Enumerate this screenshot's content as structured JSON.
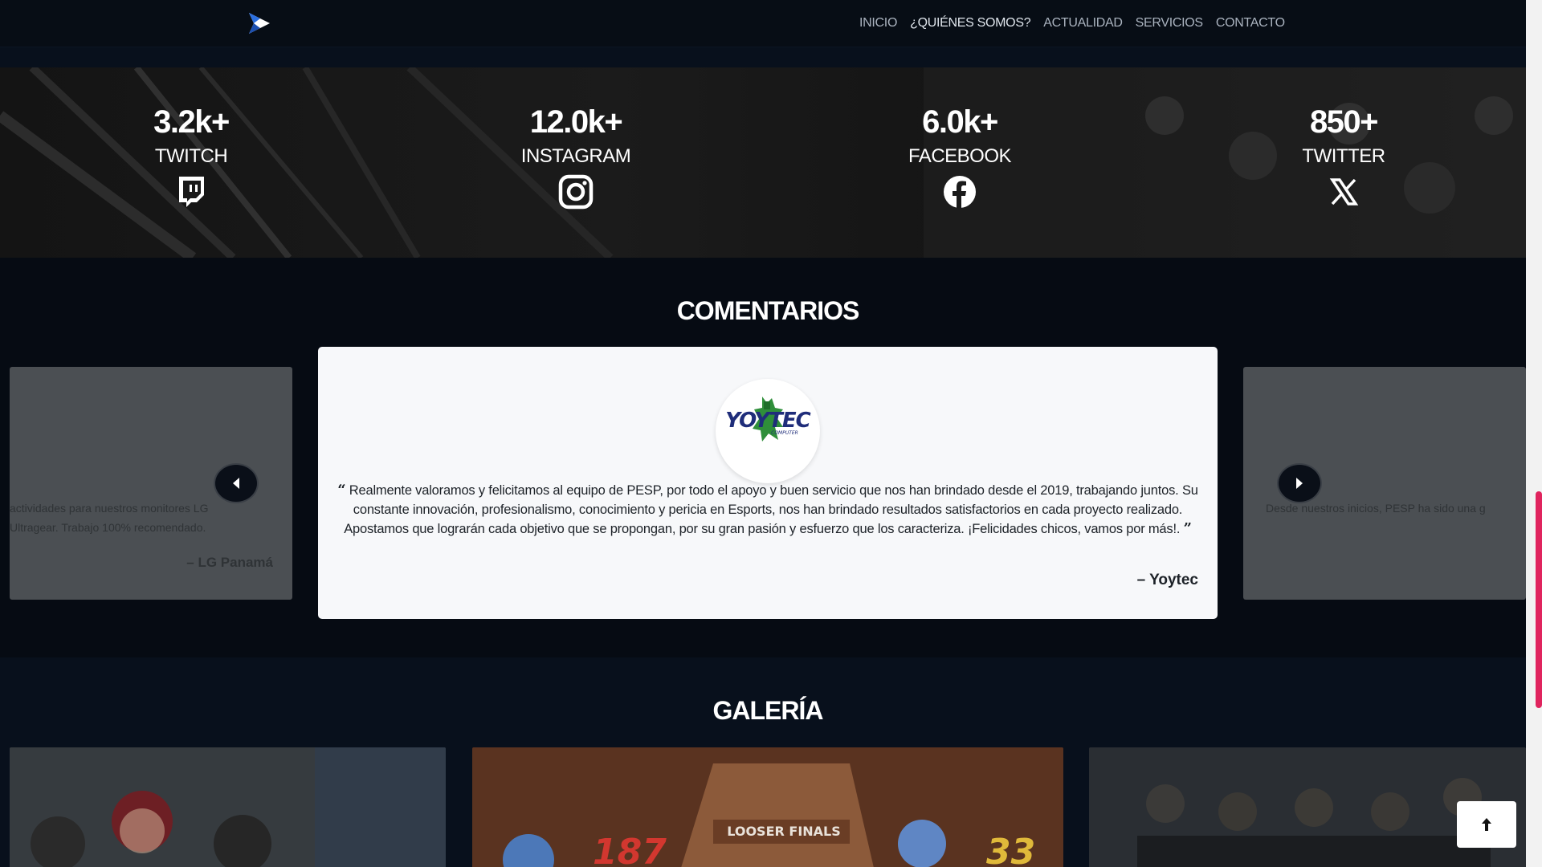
{
  "nav": {
    "logo_icon": "pesp-logo-icon",
    "links": [
      "INICIO",
      "¿QUIÉNES SOMOS?",
      "ACTUALIDAD",
      "SERVICIOS",
      "CONTACTO"
    ]
  },
  "stats": [
    {
      "value": "3.2k+",
      "label": "TWITCH",
      "icon": "twitch-icon"
    },
    {
      "value": "12.0k+",
      "label": "INSTAGRAM",
      "icon": "instagram-icon"
    },
    {
      "value": "6.0k+",
      "label": "FACEBOOK",
      "icon": "facebook-icon"
    },
    {
      "value": "850+",
      "label": "TWITTER",
      "icon": "x-icon"
    }
  ],
  "comments": {
    "title": "COMENTARIOS",
    "active": {
      "logo_text": "YOYTEC",
      "logo_subtext": "COMPUTER",
      "quote": "Realmente valoramos y felicitamos al equipo de PESP, por todo el apoyo y buen servicio que nos han brindado desde el 2019, trabajando juntos. Su constante innovación, profesionalismo, conocimiento y pericia en Esports, nos han brindado resultados satisfactorios en cada proyecto realizado. Apostamos que lograrán cada objetivo que se propongan, por su gran pasión y esfuerzo que los caracteriza. ¡Felicidades chicos, vamos por más!.",
      "author": "– Yoytec"
    },
    "prev": {
      "line1": "actividades para nuestros monitores LG",
      "line2": "Ultragear. Trabajo 100% recomendado.",
      "author": "– LG Panamá"
    },
    "next": {
      "line1": "Desde nuestros inicios, PESP ha sido una g"
    }
  },
  "gallery": {
    "title": "GALERÍA",
    "image2_banner": "LOOSER FINALS",
    "image2_score_left": "187",
    "image2_score_right": "33"
  },
  "colors": {
    "accent": "#e0245e",
    "background": "#060b13",
    "card": "#f7f8fa"
  }
}
